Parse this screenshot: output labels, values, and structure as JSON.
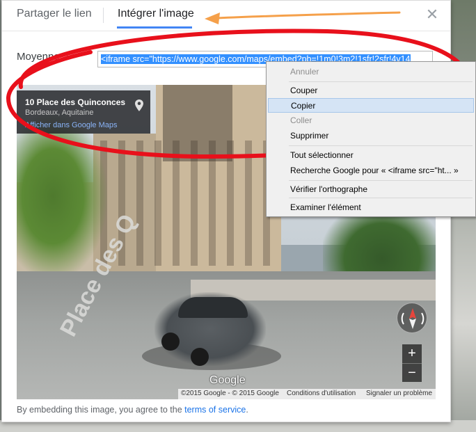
{
  "dialog": {
    "tabs": [
      {
        "label": "Partager le lien"
      },
      {
        "label": "Intégrer l'image"
      }
    ],
    "close_glyph": "✕",
    "size_select": {
      "label": "Moyenne"
    },
    "embed_input": {
      "value": "<iframe src=\"https://www.google.com/maps/embed?pb=!1m0!3m2!1sfr!2sfr!4v14"
    },
    "terms": {
      "prefix": "By embedding this image, you agree to the ",
      "link": "terms of service",
      "suffix": "."
    }
  },
  "map": {
    "place_title": "10 Place des Quinconces",
    "place_sub": "Bordeaux, Aquitaine",
    "place_link": "Afficher dans Google Maps",
    "road_text": "Place des Q",
    "google_logo": "Google",
    "zoom_in": "+",
    "zoom_out": "−",
    "footer": {
      "copyright": "©2015 Google - © 2015 Google",
      "conditions": "Conditions d'utilisation",
      "report": "Signaler un problème"
    }
  },
  "context_menu": {
    "items": [
      {
        "label": "Annuler",
        "disabled": true
      },
      {
        "label": "Couper",
        "disabled": false
      },
      {
        "label": "Copier",
        "disabled": false,
        "highlighted": true
      },
      {
        "label": "Coller",
        "disabled": true
      },
      {
        "label": "Supprimer",
        "disabled": false
      },
      {
        "label": "Tout sélectionner",
        "disabled": false
      },
      {
        "label": "Recherche Google pour « <iframe src=\"ht... »",
        "disabled": false
      },
      {
        "label": "Vérifier l'orthographe",
        "disabled": false
      },
      {
        "label": "Examiner l'élément",
        "disabled": false
      }
    ]
  },
  "colors": {
    "tab_underline": "#4285f4",
    "selection": "#3390ff",
    "annotation_arrow": "#f5a04a",
    "annotation_ellipse": "#e8101b"
  }
}
